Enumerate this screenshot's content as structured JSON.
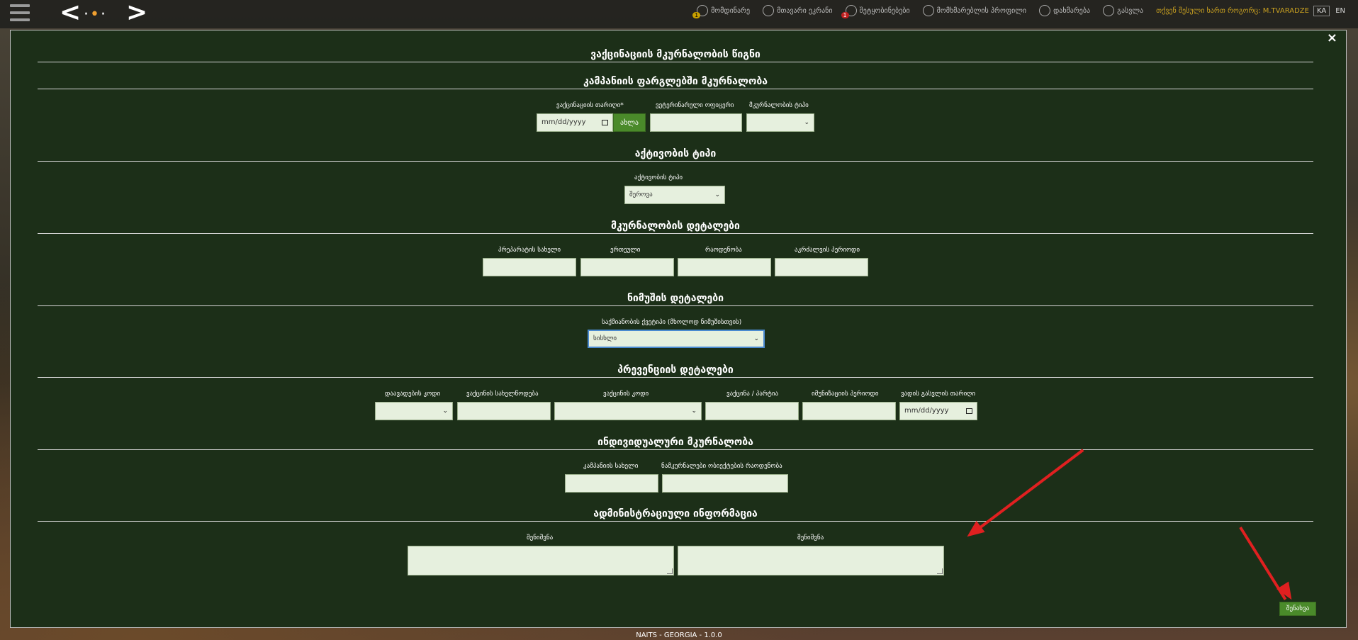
{
  "topbar": {
    "nav": [
      {
        "label": "მომდინარე",
        "icon": "bell-icon",
        "badge": "1"
      },
      {
        "label": "მთავარი ეკრანი",
        "icon": "home-icon",
        "badge": ""
      },
      {
        "label": "შეტყობინებები",
        "icon": "notification-icon",
        "badge": "1"
      },
      {
        "label": "მომხმარებლის პროფილი",
        "icon": "user-icon",
        "badge": ""
      },
      {
        "label": "დახმარება",
        "icon": "help-icon",
        "badge": ""
      },
      {
        "label": "გასვლა",
        "icon": "power-icon",
        "badge": ""
      }
    ],
    "user_prefix": "თქვენ შესული ხართ როგორც:",
    "user_name": "M.TVARADZE",
    "lang_ka": "KA",
    "lang_en": "EN"
  },
  "modal": {
    "close": "×",
    "title": "ვაქცინაციის მკურნალობის წიგნი",
    "campaign": {
      "title": "კამპანიის ფარგლებში მკურნალობა",
      "date_label": "ვაქცინაციის თარიღი*",
      "date_placeholder": "mm/dd/yyyy",
      "now_button": "ახლა",
      "vet_label": "ვეტერინარული ოფიცერი",
      "type_label": "მკურნალობის ტიპი"
    },
    "activity": {
      "title": "აქტივობის ტიპი",
      "label": "აქტივობის ტიპი",
      "value": "შეროვა"
    },
    "treatment": {
      "title": "მკურნალობის დეტალები",
      "labels": [
        "პრეპარატის სახელი",
        "ერთეული",
        "რაოდენობა",
        "აკრძალვის პერიოდი"
      ]
    },
    "sample": {
      "title": "ნიმუშის დეტალები",
      "label": "საქმიანობის ქვეტიპი (მხოლოდ ნიმუშისთვის)",
      "value": "სისხლი"
    },
    "prevention": {
      "title": "პრევენციის დეტალები",
      "labels": [
        "დაავადების კოდი",
        "ვაქცინის სახელწოდება",
        "ვაქცინის კოდი",
        "ვაქცინა / პარტია",
        "იმუნიზაციის პერიოდი",
        "ვადის გასვლის თარიღი"
      ],
      "date_placeholder": "mm/dd/yyyy"
    },
    "individual": {
      "title": "ინდივიდუალური მკურნალობა",
      "labels": [
        "კამპანიის სახელი",
        "ნამკურნალები ობიექტების რაოდენობა"
      ]
    },
    "admin": {
      "title": "ადმინისტრაციული ინფორმაცია",
      "note1": "შენიშვნა",
      "note2": "შენიშვნა"
    },
    "save_button": "შენახვა"
  },
  "footer": "NAITS - GEORGIA - 1.0.0",
  "colors": {
    "modal_bg": "#1c2f18",
    "input_bg": "#e6f0de",
    "button_green": "#4a8a2a",
    "annotation_arrow": "#e02020"
  }
}
